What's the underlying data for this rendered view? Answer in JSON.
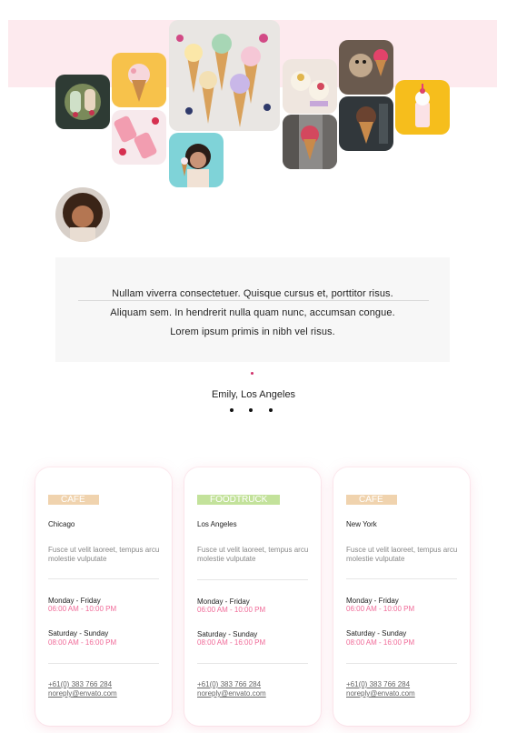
{
  "testimonial": {
    "quote_lines": [
      "Nullam viverra consectetuer. Quisque cursus et, porttitor risus.",
      "Aliquam sem. In hendrerit nulla quam nunc, accumsan congue.",
      "Lorem ipsum primis in nibh vel risus."
    ],
    "author": "Emily, Los Angeles"
  },
  "colors": {
    "band": "#fdeaee",
    "accent_pink": "#f06a98",
    "badge_cafe": "#f0d3ae",
    "badge_foodtruck": "#c3e29b"
  },
  "locations": [
    {
      "badge": "CAFE",
      "badge_color": "#f0d3ae",
      "city": "Chicago",
      "description": "Fusce ut velit laoreet, tempus arcu molestie vulputate",
      "weekday_label": "Monday - Friday",
      "weekday_hours": "06:00 AM - 10:00 PM",
      "weekend_label": "Saturday - Sunday",
      "weekend_hours": "08:00 AM - 16:00 PM",
      "phone": "+61(0) 383 766 284",
      "email": "noreply@envato.com"
    },
    {
      "badge": "FOODTRUCK",
      "badge_color": "#c3e29b",
      "city": "Los Angeles",
      "description": "Fusce ut velit laoreet, tempus arcu molestie vulputate",
      "weekday_label": "Monday - Friday",
      "weekday_hours": "06:00 AM - 10:00 PM",
      "weekend_label": "Saturday - Sunday",
      "weekend_hours": "08:00 AM - 16:00 PM",
      "phone": "+61(0) 383 766 284",
      "email": "noreply@envato.com"
    },
    {
      "badge": "CAFE",
      "badge_color": "#f0d3ae",
      "city": "New York",
      "description": "Fusce ut velit laoreet, tempus arcu molestie vulputate",
      "weekday_label": "Monday - Friday",
      "weekday_hours": "06:00 AM - 10:00 PM",
      "weekend_label": "Saturday - Sunday",
      "weekend_hours": "08:00 AM - 16:00 PM",
      "phone": "+61(0) 383 766 284",
      "email": "noreply@envato.com"
    }
  ]
}
